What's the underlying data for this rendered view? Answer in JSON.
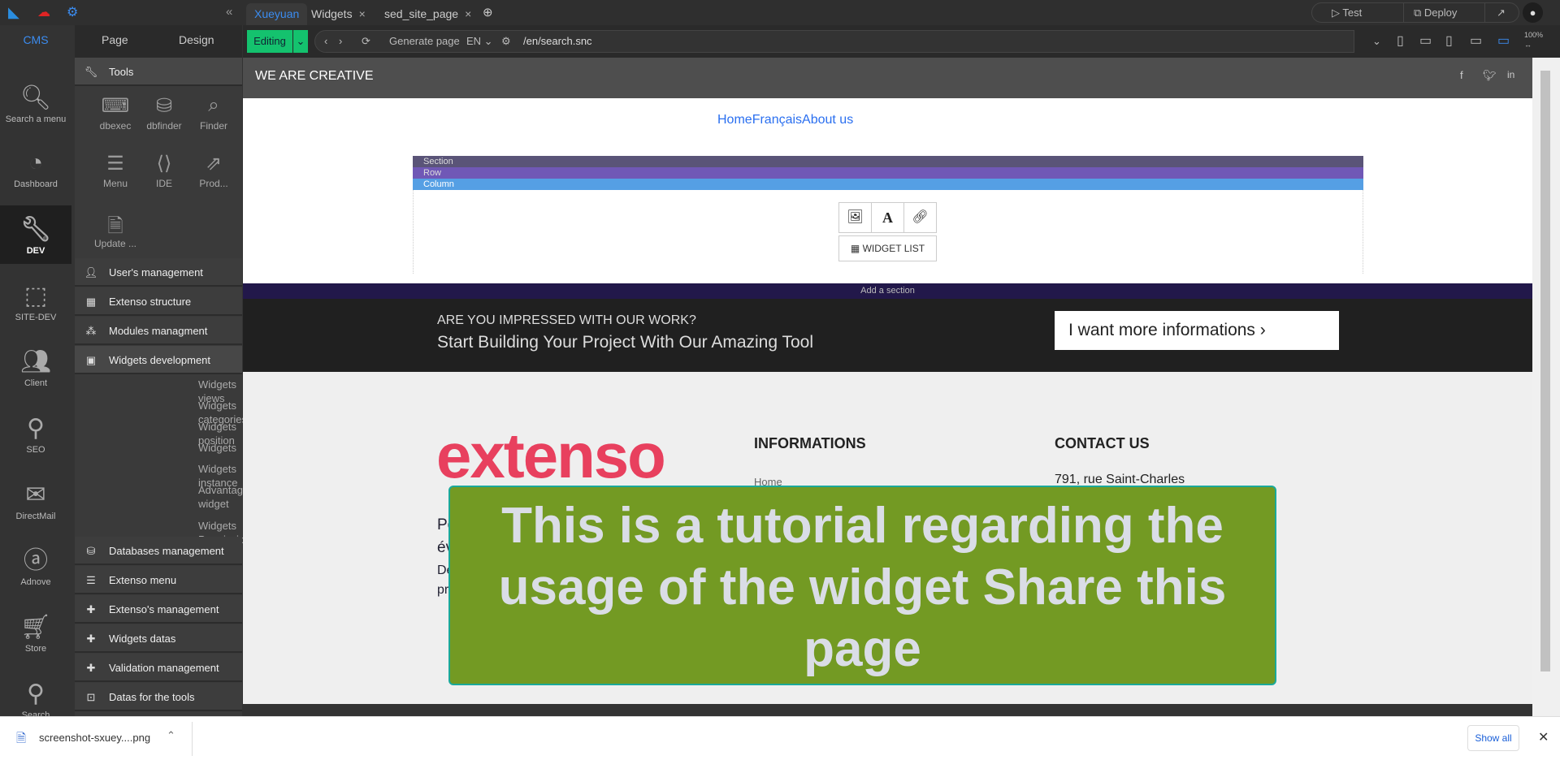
{
  "topbar": {
    "tabs": [
      {
        "label": "Xueyuan"
      },
      {
        "label": "Widgets"
      },
      {
        "label": "sed_site_page"
      }
    ],
    "collapse": "«",
    "test": "Test",
    "deploy": "Deploy"
  },
  "toolbar": {
    "mode": "Editing",
    "generate": "Generate page",
    "lang": "EN",
    "url": "/en/search.snc",
    "zoom": "100%"
  },
  "sidebar_tabs": {
    "cms": "CMS",
    "page": "Page",
    "design": "Design"
  },
  "iconcol": [
    {
      "label": "Search a menu",
      "icon": "search"
    },
    {
      "label": "Dashboard",
      "icon": "gauge"
    },
    {
      "label": "DEV",
      "icon": "wrench"
    },
    {
      "label": "SITE-DEV",
      "icon": "cube"
    },
    {
      "label": "Client",
      "icon": "users"
    },
    {
      "label": "SEO",
      "icon": "seo"
    },
    {
      "label": "DirectMail",
      "icon": "mail"
    },
    {
      "label": "Adnove",
      "icon": "ad"
    },
    {
      "label": "Store",
      "icon": "cart"
    },
    {
      "label": "Search",
      "icon": "search"
    }
  ],
  "panel": {
    "tools_header": "Tools",
    "tools": [
      {
        "label": "dbexec"
      },
      {
        "label": "dbfinder"
      },
      {
        "label": "Finder"
      },
      {
        "label": "Menu"
      },
      {
        "label": "IDE"
      },
      {
        "label": "Prod..."
      },
      {
        "label": "Update ..."
      }
    ],
    "items_top": [
      {
        "label": "User's management"
      },
      {
        "label": "Extenso structure"
      },
      {
        "label": "Modules managment"
      },
      {
        "label": "Widgets development"
      }
    ],
    "subitems": [
      {
        "label": "Widgets views"
      },
      {
        "label": "Widgets categories"
      },
      {
        "label": "Widgets position"
      },
      {
        "label": "Widgets"
      },
      {
        "label": "Widgets instance"
      },
      {
        "label": "Advantages of the widget"
      },
      {
        "label": "Widgets Permissions"
      }
    ],
    "items_bottom": [
      {
        "label": "Databases management"
      },
      {
        "label": "Extenso menu"
      },
      {
        "label": "Extenso's management"
      },
      {
        "label": "Widgets datas"
      },
      {
        "label": "Validation management"
      },
      {
        "label": "Datas for the tools"
      }
    ]
  },
  "site": {
    "header": "WE ARE CREATIVE",
    "nav": [
      "Home",
      "Français",
      "About us"
    ],
    "section": "Section",
    "row": "Row",
    "column": "Column",
    "widget_list": "WIDGET LIST",
    "add_section": "Add a section",
    "cta_small": "ARE YOU IMPRESSED WITH OUR WORK?",
    "cta_big": "Start Building Your Project With Our Amazing Tool",
    "cta_button": "I want more informations ›",
    "logo": "extenso",
    "info_title": "INFORMATIONS",
    "info_home": "Home",
    "contact_title": "CONTACT US",
    "address": "791, rue Saint-Charles",
    "frag": [
      "Po",
      "év",
      "De",
      "pr"
    ]
  },
  "overlay": "This is a tutorial regarding the usage of the widget Share this page",
  "download": {
    "file": "screenshot-sxuey....png",
    "show_all": "Show all"
  },
  "colors": {
    "accent": "#3b8cf0",
    "editing": "#14c26e",
    "section": "#5a5478",
    "row": "#7058b6",
    "column": "#559fe4",
    "overlay": "#739a23"
  }
}
